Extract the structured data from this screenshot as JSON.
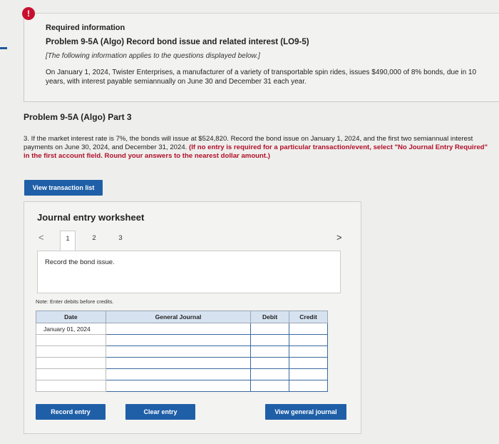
{
  "header": {
    "alert_glyph": "!",
    "required": "Required information",
    "problem_title": "Problem 9-5A (Algo) Record bond issue and related interest (LO9-5)",
    "applies_note": "[The following information applies to the questions displayed below.]",
    "description": "On January 1, 2024, Twister Enterprises, a manufacturer of a variety of transportable spin rides, issues $490,000 of 8% bonds, due in 10 years, with interest payable semiannually on June 30 and December 31 each year."
  },
  "part": {
    "title": "Problem 9-5A (Algo) Part 3",
    "question_main": "3. If the market interest rate is 7%, the bonds will issue at $524,820. Record the bond issue on January 1, 2024, and the first two semiannual interest payments on June 30, 2024, and December 31, 2024. ",
    "question_emphasis": "(If no entry is required for a particular transaction/event, select \"No Journal Entry Required\" in the first account field. Round your answers to the nearest dollar amount.)"
  },
  "buttons": {
    "view_transaction_list": "View transaction list",
    "record_entry": "Record entry",
    "clear_entry": "Clear entry",
    "view_general_journal": "View general journal"
  },
  "worksheet": {
    "title": "Journal entry worksheet",
    "prev": "<",
    "next": ">",
    "tabs": [
      "1",
      "2",
      "3"
    ],
    "instruction": "Record the bond issue.",
    "note": "Note: Enter debits before credits.",
    "columns": [
      "Date",
      "General Journal",
      "Debit",
      "Credit"
    ],
    "rows": [
      "January 01, 2024",
      "",
      "",
      "",
      "",
      ""
    ]
  },
  "colors": {
    "button_blue": "#1f5fa8",
    "alert_red": "#c8102e",
    "emphasis_red": "#b0102a",
    "header_blue": "#d6e2f0"
  }
}
